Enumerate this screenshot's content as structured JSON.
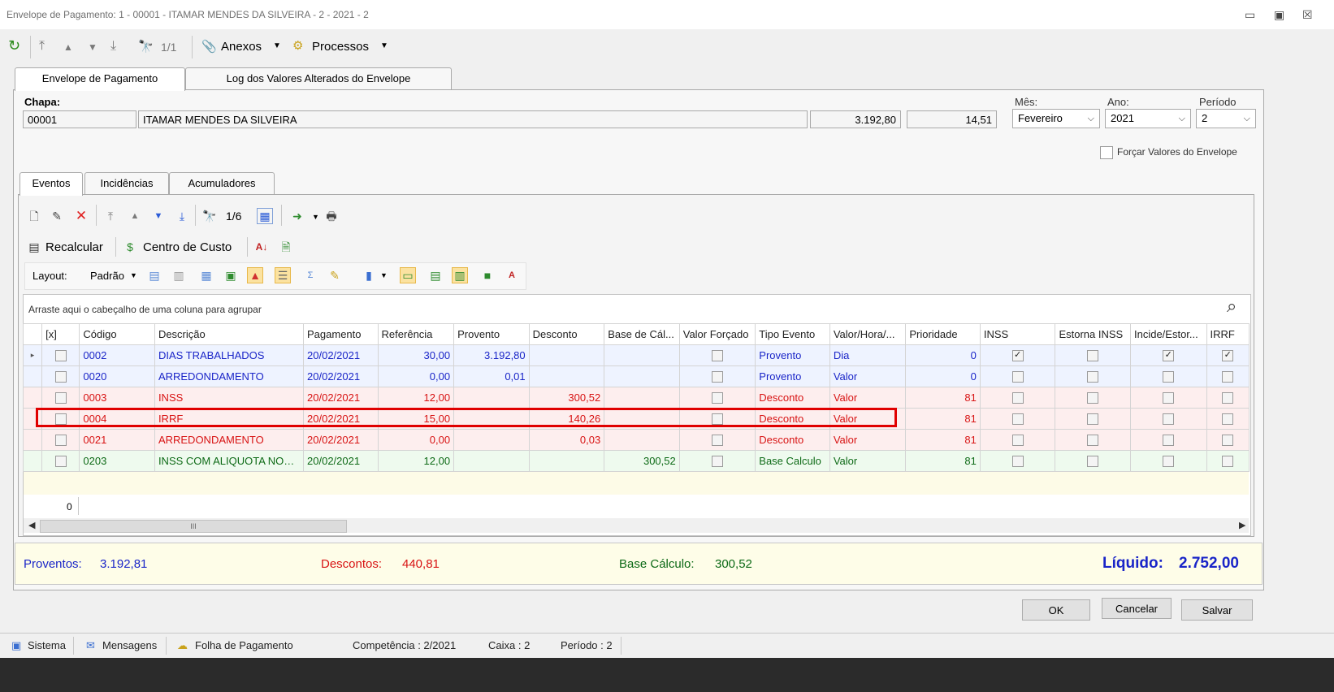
{
  "window": {
    "title": "Envelope de Pagamento: 1 - 00001 - ITAMAR MENDES DA SILVEIRA - 2 - 2021 - 2",
    "controls": {
      "minimize": "▭",
      "restore": "▣",
      "close": "☒"
    }
  },
  "toolbar": {
    "counter": "1/1",
    "anexos_label": "Anexos",
    "processos_label": "Processos"
  },
  "tabs": [
    "Envelope de Pagamento",
    "Log dos Valores Alterados do Envelope"
  ],
  "header": {
    "chapa_label": "Chapa:",
    "chapa_value": "00001",
    "nome_value": "ITAMAR MENDES DA SILVEIRA",
    "valor1": "3.192,80",
    "valor2": "14,51",
    "mes_label": "Mês:",
    "mes_value": "Fevereiro",
    "ano_label": "Ano:",
    "ano_value": "2021",
    "periodo_label": "Período",
    "periodo_value": "2",
    "forcar_label": "Forçar Valores do Envelope"
  },
  "inner_tabs": [
    "Eventos",
    "Incidências",
    "Acumuladores"
  ],
  "events_toolbar": {
    "counter": "1/6",
    "recalcular": "Recalcular",
    "centro_custo": "Centro de Custo",
    "layout_label": "Layout:",
    "padrao_label": "Padrão"
  },
  "grid": {
    "group_hint": "Arraste aqui o cabeçalho de uma coluna para agrupar",
    "columns": [
      "[x]",
      "Código",
      "Descrição",
      "Pagamento",
      "Referência",
      "Provento",
      "Desconto",
      "Base de Cál...",
      "Valor Forçado",
      "Tipo Evento",
      "Valor/Hora/...",
      "Prioridade",
      "INSS",
      "Estorna INSS",
      "Incide/Estor...",
      "IRRF"
    ],
    "rows": [
      {
        "codigo": "0002",
        "descricao": "DIAS TRABALHADOS",
        "pagamento": "20/02/2021",
        "referencia": "30,00",
        "provento": "3.192,80",
        "desconto": "",
        "base": "",
        "tipo": "Provento",
        "vh": "Dia",
        "prioridade": "0",
        "color": "blue",
        "inss": true,
        "estorna": false,
        "incide": true,
        "irrf": true
      },
      {
        "codigo": "0020",
        "descricao": "ARREDONDAMENTO",
        "pagamento": "20/02/2021",
        "referencia": "0,00",
        "provento": "0,01",
        "desconto": "",
        "base": "",
        "tipo": "Provento",
        "vh": "Valor",
        "prioridade": "0",
        "color": "blue",
        "inss": false,
        "estorna": false,
        "incide": false,
        "irrf": false
      },
      {
        "codigo": "0003",
        "descricao": "INSS",
        "pagamento": "20/02/2021",
        "referencia": "12,00",
        "provento": "",
        "desconto": "300,52",
        "base": "",
        "tipo": "Desconto",
        "vh": "Valor",
        "prioridade": "81",
        "color": "red",
        "inss": false,
        "estorna": false,
        "incide": false,
        "irrf": false
      },
      {
        "codigo": "0004",
        "descricao": "IRRF",
        "pagamento": "20/02/2021",
        "referencia": "15,00",
        "provento": "",
        "desconto": "140,26",
        "base": "",
        "tipo": "Desconto",
        "vh": "Valor",
        "prioridade": "81",
        "color": "red",
        "inss": false,
        "estorna": false,
        "incide": false,
        "irrf": false
      },
      {
        "codigo": "0021",
        "descricao": "ARREDONDAMENTO",
        "pagamento": "20/02/2021",
        "referencia": "0,00",
        "provento": "",
        "desconto": "0,03",
        "base": "",
        "tipo": "Desconto",
        "vh": "Valor",
        "prioridade": "81",
        "color": "red",
        "inss": false,
        "estorna": false,
        "incide": false,
        "irrf": false
      },
      {
        "codigo": "0203",
        "descricao": "INSS COM ALIQUOTA NOR...",
        "pagamento": "20/02/2021",
        "referencia": "12,00",
        "provento": "",
        "desconto": "",
        "base": "300,52",
        "tipo": "Base Calculo",
        "vh": "Valor",
        "prioridade": "81",
        "color": "green",
        "inss": false,
        "estorna": false,
        "incide": false,
        "irrf": false
      }
    ],
    "footer_count": "0",
    "scroll_grip": "III"
  },
  "summary": {
    "proventos_label": "Proventos:",
    "proventos_value": "3.192,81",
    "descontos_label": "Descontos:",
    "descontos_value": "440,81",
    "base_label": "Base Cálculo:",
    "base_value": "300,52",
    "liquido_label": "Líquido:",
    "liquido_value": "2.752,00"
  },
  "buttons": {
    "ok": "OK",
    "cancelar": "Cancelar",
    "salvar": "Salvar"
  },
  "statusbar": {
    "sistema": "Sistema",
    "mensagens": "Mensagens",
    "folha": "Folha de Pagamento",
    "competencia": "Competência : 2/2021",
    "caixa": "Caixa : 2",
    "periodo": "Período : 2"
  },
  "colors": {
    "blue": "#1a25c8",
    "red": "#d81313",
    "green": "#0d6a16",
    "highlight": "#e00000"
  }
}
